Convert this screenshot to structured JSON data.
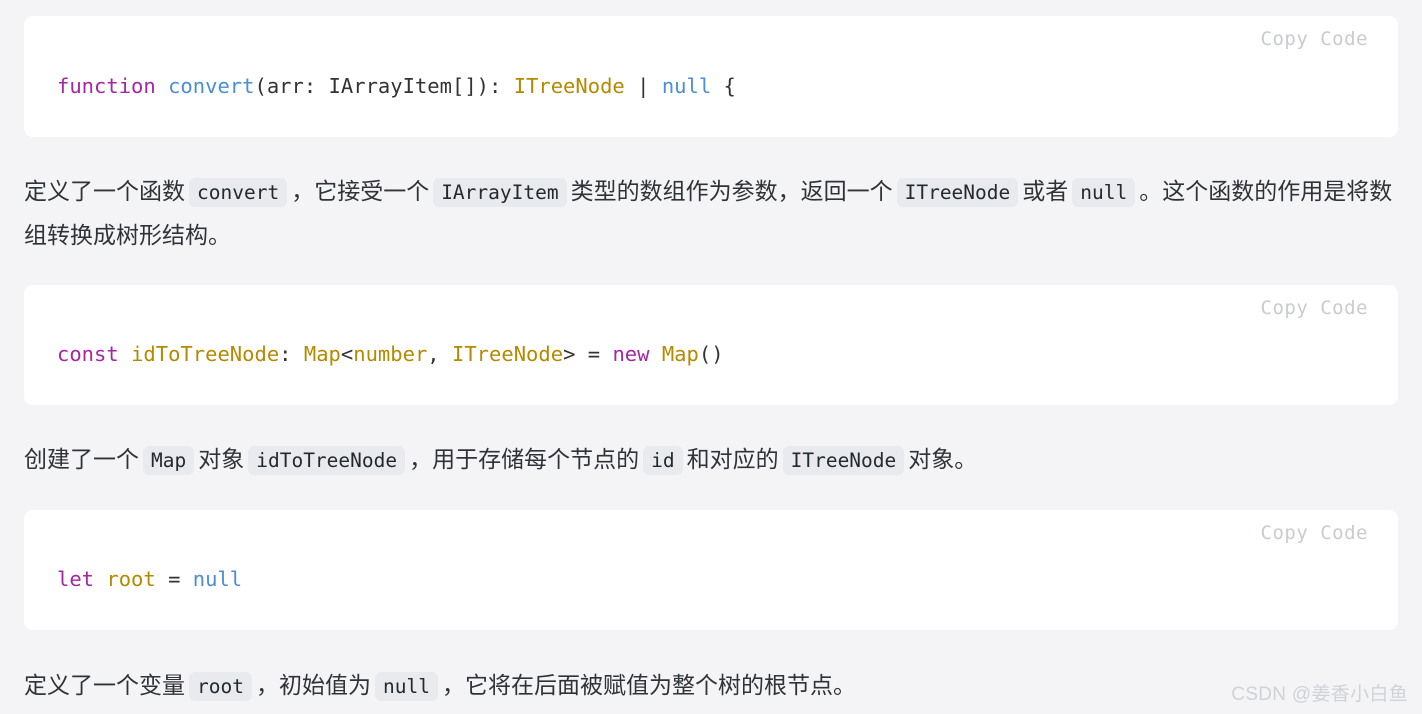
{
  "page": {
    "background_color": "#f4f4f6",
    "text_color": "#2f3337",
    "code_block_bg": "#ffffff",
    "inline_code_bg": "#e8eaed"
  },
  "copy_label": "Copy Code",
  "code_blocks": [
    {
      "id": "code-block-1",
      "copy_label": "Copy Code",
      "tokens": [
        {
          "text": "function",
          "kind": "keyword"
        },
        {
          "text": " ",
          "kind": "plain"
        },
        {
          "text": "convert",
          "kind": "function"
        },
        {
          "text": "(arr: IArrayItem[]): ",
          "kind": "plain"
        },
        {
          "text": "ITreeNode",
          "kind": "type"
        },
        {
          "text": " | ",
          "kind": "plain"
        },
        {
          "text": "null",
          "kind": "literal"
        },
        {
          "text": " {",
          "kind": "plain"
        }
      ],
      "plain_text": "function convert(arr: IArrayItem[]): ITreeNode | null {"
    },
    {
      "id": "code-block-2",
      "copy_label": "Copy Code",
      "tokens": [
        {
          "text": "const",
          "kind": "keyword"
        },
        {
          "text": " ",
          "kind": "plain"
        },
        {
          "text": "idToTreeNode",
          "kind": "type"
        },
        {
          "text": ": ",
          "kind": "plain"
        },
        {
          "text": "Map",
          "kind": "type"
        },
        {
          "text": "<",
          "kind": "plain"
        },
        {
          "text": "number",
          "kind": "type"
        },
        {
          "text": ", ",
          "kind": "plain"
        },
        {
          "text": "ITreeNode",
          "kind": "type"
        },
        {
          "text": "> = ",
          "kind": "plain"
        },
        {
          "text": "new",
          "kind": "keyword"
        },
        {
          "text": " ",
          "kind": "plain"
        },
        {
          "text": "Map",
          "kind": "type"
        },
        {
          "text": "()",
          "kind": "plain"
        }
      ],
      "plain_text": "const idToTreeNode: Map<number, ITreeNode> = new Map()"
    },
    {
      "id": "code-block-3",
      "copy_label": "Copy Code",
      "tokens": [
        {
          "text": "let",
          "kind": "keyword"
        },
        {
          "text": " ",
          "kind": "plain"
        },
        {
          "text": "root",
          "kind": "type"
        },
        {
          "text": " = ",
          "kind": "plain"
        },
        {
          "text": "null",
          "kind": "literal"
        }
      ],
      "plain_text": "let root = null"
    }
  ],
  "paragraphs": [
    {
      "id": "paragraph-1",
      "runs": [
        {
          "text": "定义了一个函数",
          "kind": "text"
        },
        {
          "text": "convert",
          "kind": "code"
        },
        {
          "text": "，它接受一个",
          "kind": "text"
        },
        {
          "text": "IArrayItem",
          "kind": "code"
        },
        {
          "text": "类型的数组作为参数，返回一个",
          "kind": "text"
        },
        {
          "text": "ITreeNode",
          "kind": "code"
        },
        {
          "text": "或者",
          "kind": "text"
        },
        {
          "text": "null",
          "kind": "code"
        },
        {
          "text": "。这个函数的作用是将数组转换成树形结构。",
          "kind": "text"
        }
      ]
    },
    {
      "id": "paragraph-2",
      "runs": [
        {
          "text": "创建了一个",
          "kind": "text"
        },
        {
          "text": "Map",
          "kind": "code"
        },
        {
          "text": "对象",
          "kind": "text"
        },
        {
          "text": "idToTreeNode",
          "kind": "code"
        },
        {
          "text": "，用于存储每个节点的",
          "kind": "text"
        },
        {
          "text": "id",
          "kind": "code"
        },
        {
          "text": "和对应的",
          "kind": "text"
        },
        {
          "text": "ITreeNode",
          "kind": "code"
        },
        {
          "text": "对象。",
          "kind": "text"
        }
      ]
    },
    {
      "id": "paragraph-3",
      "runs": [
        {
          "text": "定义了一个变量",
          "kind": "text"
        },
        {
          "text": "root",
          "kind": "code"
        },
        {
          "text": "，初始值为",
          "kind": "text"
        },
        {
          "text": "null",
          "kind": "code"
        },
        {
          "text": "，它将在后面被赋值为整个树的根节点。",
          "kind": "text"
        }
      ]
    }
  ],
  "watermark": "CSDN @姜香小白鱼"
}
